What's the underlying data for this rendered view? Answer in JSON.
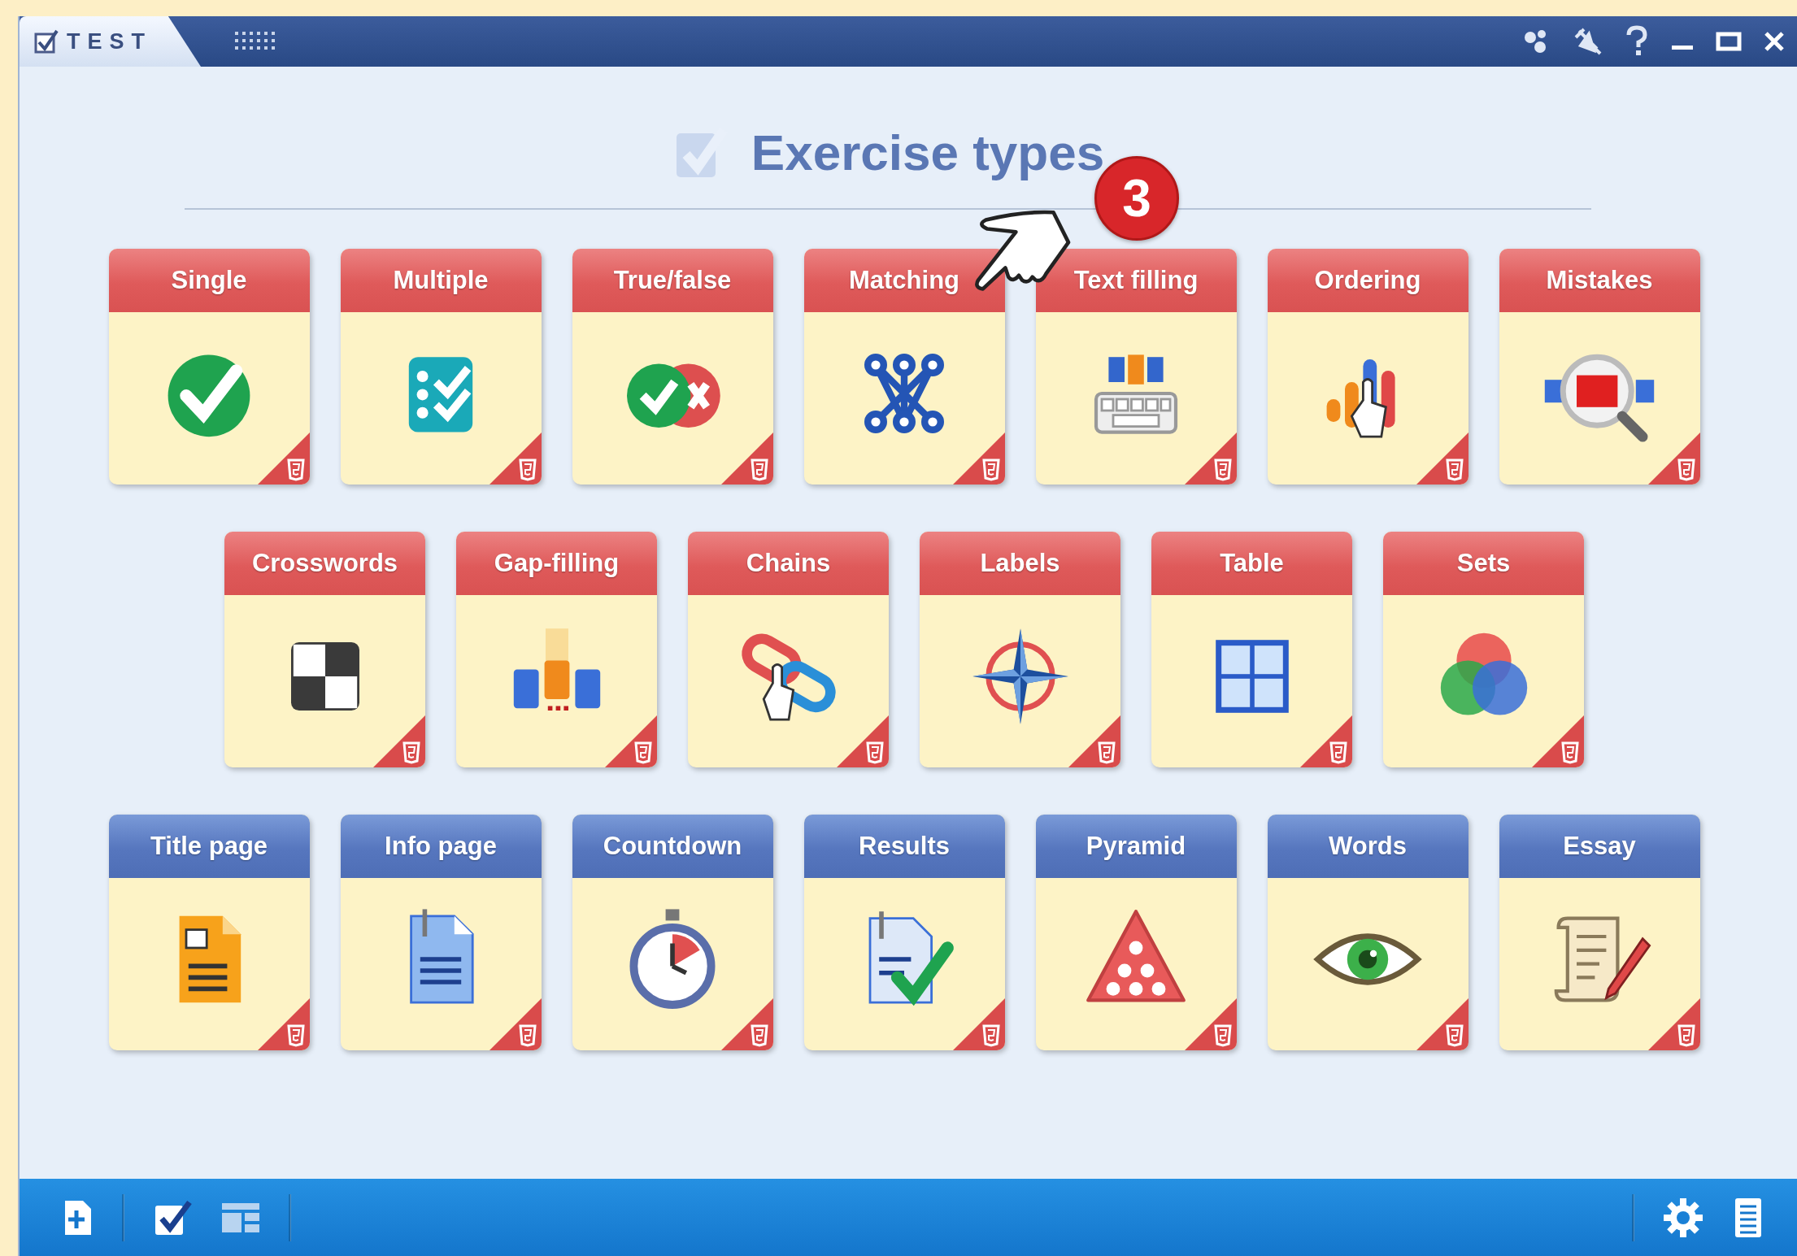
{
  "window": {
    "tab_label": "TEST"
  },
  "heading": "Exercise types",
  "callout": {
    "number": "3"
  },
  "rows": [
    {
      "cards": [
        {
          "label": "Single",
          "kind": "question"
        },
        {
          "label": "Multiple",
          "kind": "question"
        },
        {
          "label": "True/false",
          "kind": "question"
        },
        {
          "label": "Matching",
          "kind": "question"
        },
        {
          "label": "Text filling",
          "kind": "question"
        },
        {
          "label": "Ordering",
          "kind": "question"
        },
        {
          "label": "Mistakes",
          "kind": "question"
        }
      ]
    },
    {
      "cards": [
        {
          "label": "Crosswords",
          "kind": "question"
        },
        {
          "label": "Gap-filling",
          "kind": "question"
        },
        {
          "label": "Chains",
          "kind": "question"
        },
        {
          "label": "Labels",
          "kind": "question"
        },
        {
          "label": "Table",
          "kind": "question"
        },
        {
          "label": "Sets",
          "kind": "question"
        }
      ]
    },
    {
      "cards": [
        {
          "label": "Title page",
          "kind": "page"
        },
        {
          "label": "Info page",
          "kind": "page"
        },
        {
          "label": "Countdown",
          "kind": "page"
        },
        {
          "label": "Results",
          "kind": "page"
        },
        {
          "label": "Pyramid",
          "kind": "page"
        },
        {
          "label": "Words",
          "kind": "page"
        },
        {
          "label": "Essay",
          "kind": "page"
        }
      ]
    }
  ]
}
